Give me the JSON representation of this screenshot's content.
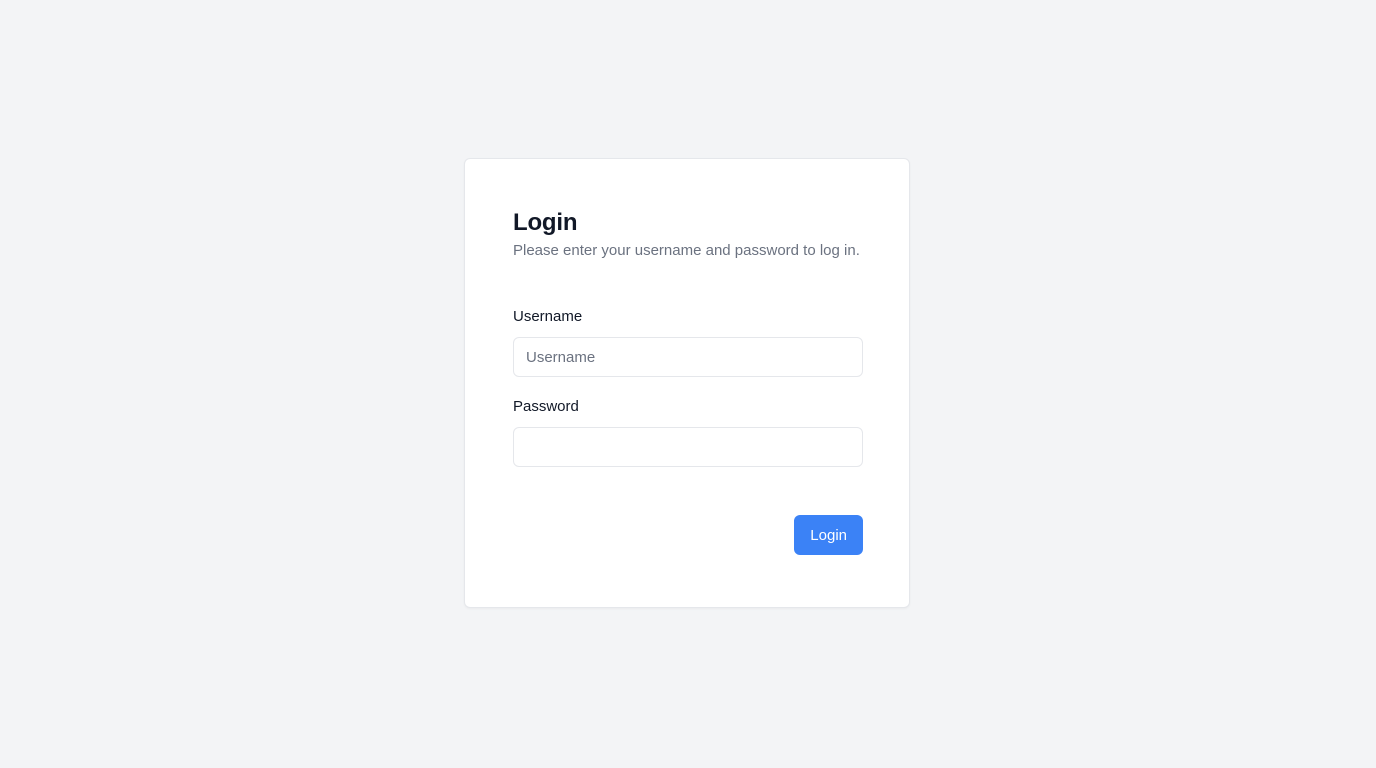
{
  "login_form": {
    "title": "Login",
    "subtitle": "Please enter your username and password to log in.",
    "username": {
      "label": "Username",
      "placeholder": "Username",
      "value": ""
    },
    "password": {
      "label": "Password",
      "placeholder": "",
      "value": ""
    },
    "submit_label": "Login"
  },
  "colors": {
    "background": "#f3f4f6",
    "card": "#ffffff",
    "accent": "#3b82f6",
    "text_primary": "#111827",
    "text_muted": "#6b7280",
    "border": "#e5e7eb"
  }
}
